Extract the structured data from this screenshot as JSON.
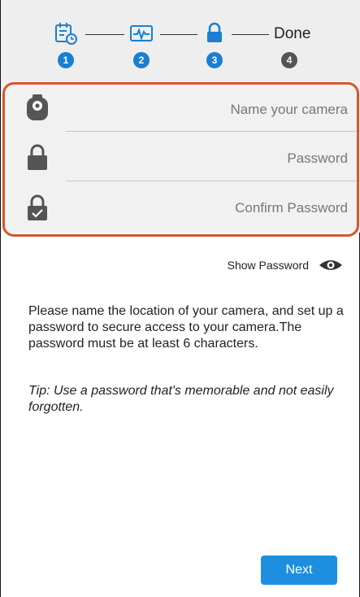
{
  "stepper": {
    "steps": [
      {
        "icon": "calendar-clock-icon",
        "number": "1",
        "state": "active"
      },
      {
        "icon": "heartbeat-monitor-icon",
        "number": "2",
        "state": "active"
      },
      {
        "icon": "lock-icon",
        "number": "3",
        "state": "active"
      },
      {
        "label": "Done",
        "number": "4",
        "state": "inactive"
      }
    ]
  },
  "form": {
    "camera_name": {
      "placeholder": "Name your camera",
      "value": "",
      "icon": "camera-icon"
    },
    "password": {
      "placeholder": "Password",
      "value": "",
      "icon": "lock-icon"
    },
    "confirm_password": {
      "placeholder": "Confirm Password",
      "value": "",
      "icon": "lock-check-icon"
    }
  },
  "show_password": {
    "label": "Show Password",
    "icon": "eye-icon"
  },
  "description": "Please name the location of your camera, and set up a password to secure access to your camera.The password must be at least 6 characters.",
  "tip": "Tip: Use a password that's memorable and not easily forgotten.",
  "next_button": {
    "label": "Next"
  },
  "colors": {
    "accent": "#1e8fe0",
    "highlight": "#d4582a",
    "step_inactive": "#555555"
  }
}
